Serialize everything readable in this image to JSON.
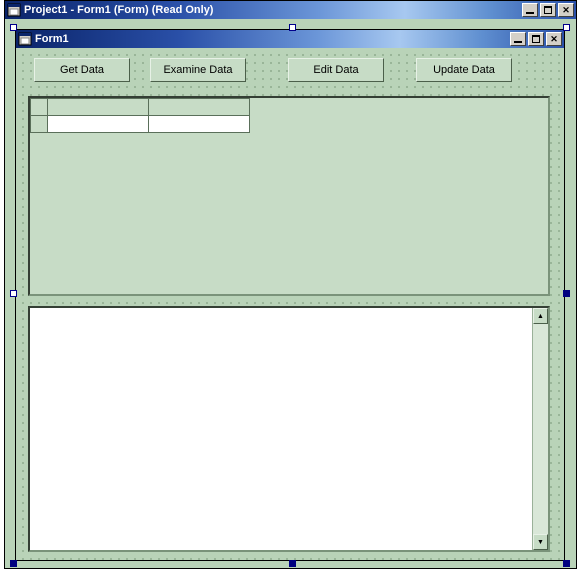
{
  "outer": {
    "title": "Project1 - Form1 (Form)  (Read Only)"
  },
  "inner": {
    "title": "Form1"
  },
  "buttons": {
    "get": "Get Data",
    "examine": "Examine Data",
    "edit": "Edit Data",
    "update": "Update Data"
  },
  "grid": {
    "cols": 3,
    "rows": 2
  },
  "icons": {
    "form": "form-icon"
  }
}
